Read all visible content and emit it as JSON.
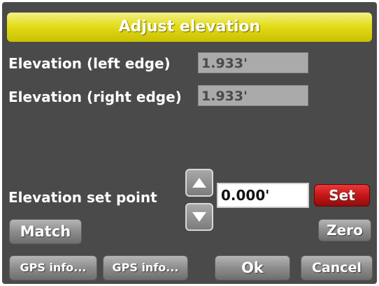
{
  "title": "Adjust elevation",
  "elevation_left": {
    "label": "Elevation (left edge)",
    "value": "1.933'"
  },
  "elevation_right": {
    "label": "Elevation (right edge)",
    "value": "1.933'"
  },
  "set_point": {
    "label": "Elevation set point",
    "value": "0.000'"
  },
  "buttons": {
    "set": "Set",
    "match": "Match",
    "zero": "Zero",
    "gps_info_1": "GPS info...",
    "gps_info_2": "GPS info...",
    "ok": "Ok",
    "cancel": "Cancel"
  },
  "icons": {
    "up": "up-arrow-icon",
    "down": "down-arrow-icon"
  },
  "colors": {
    "title_bar": "#e4dd1a",
    "set_button": "#c41616",
    "background": "#4a4a4a"
  }
}
